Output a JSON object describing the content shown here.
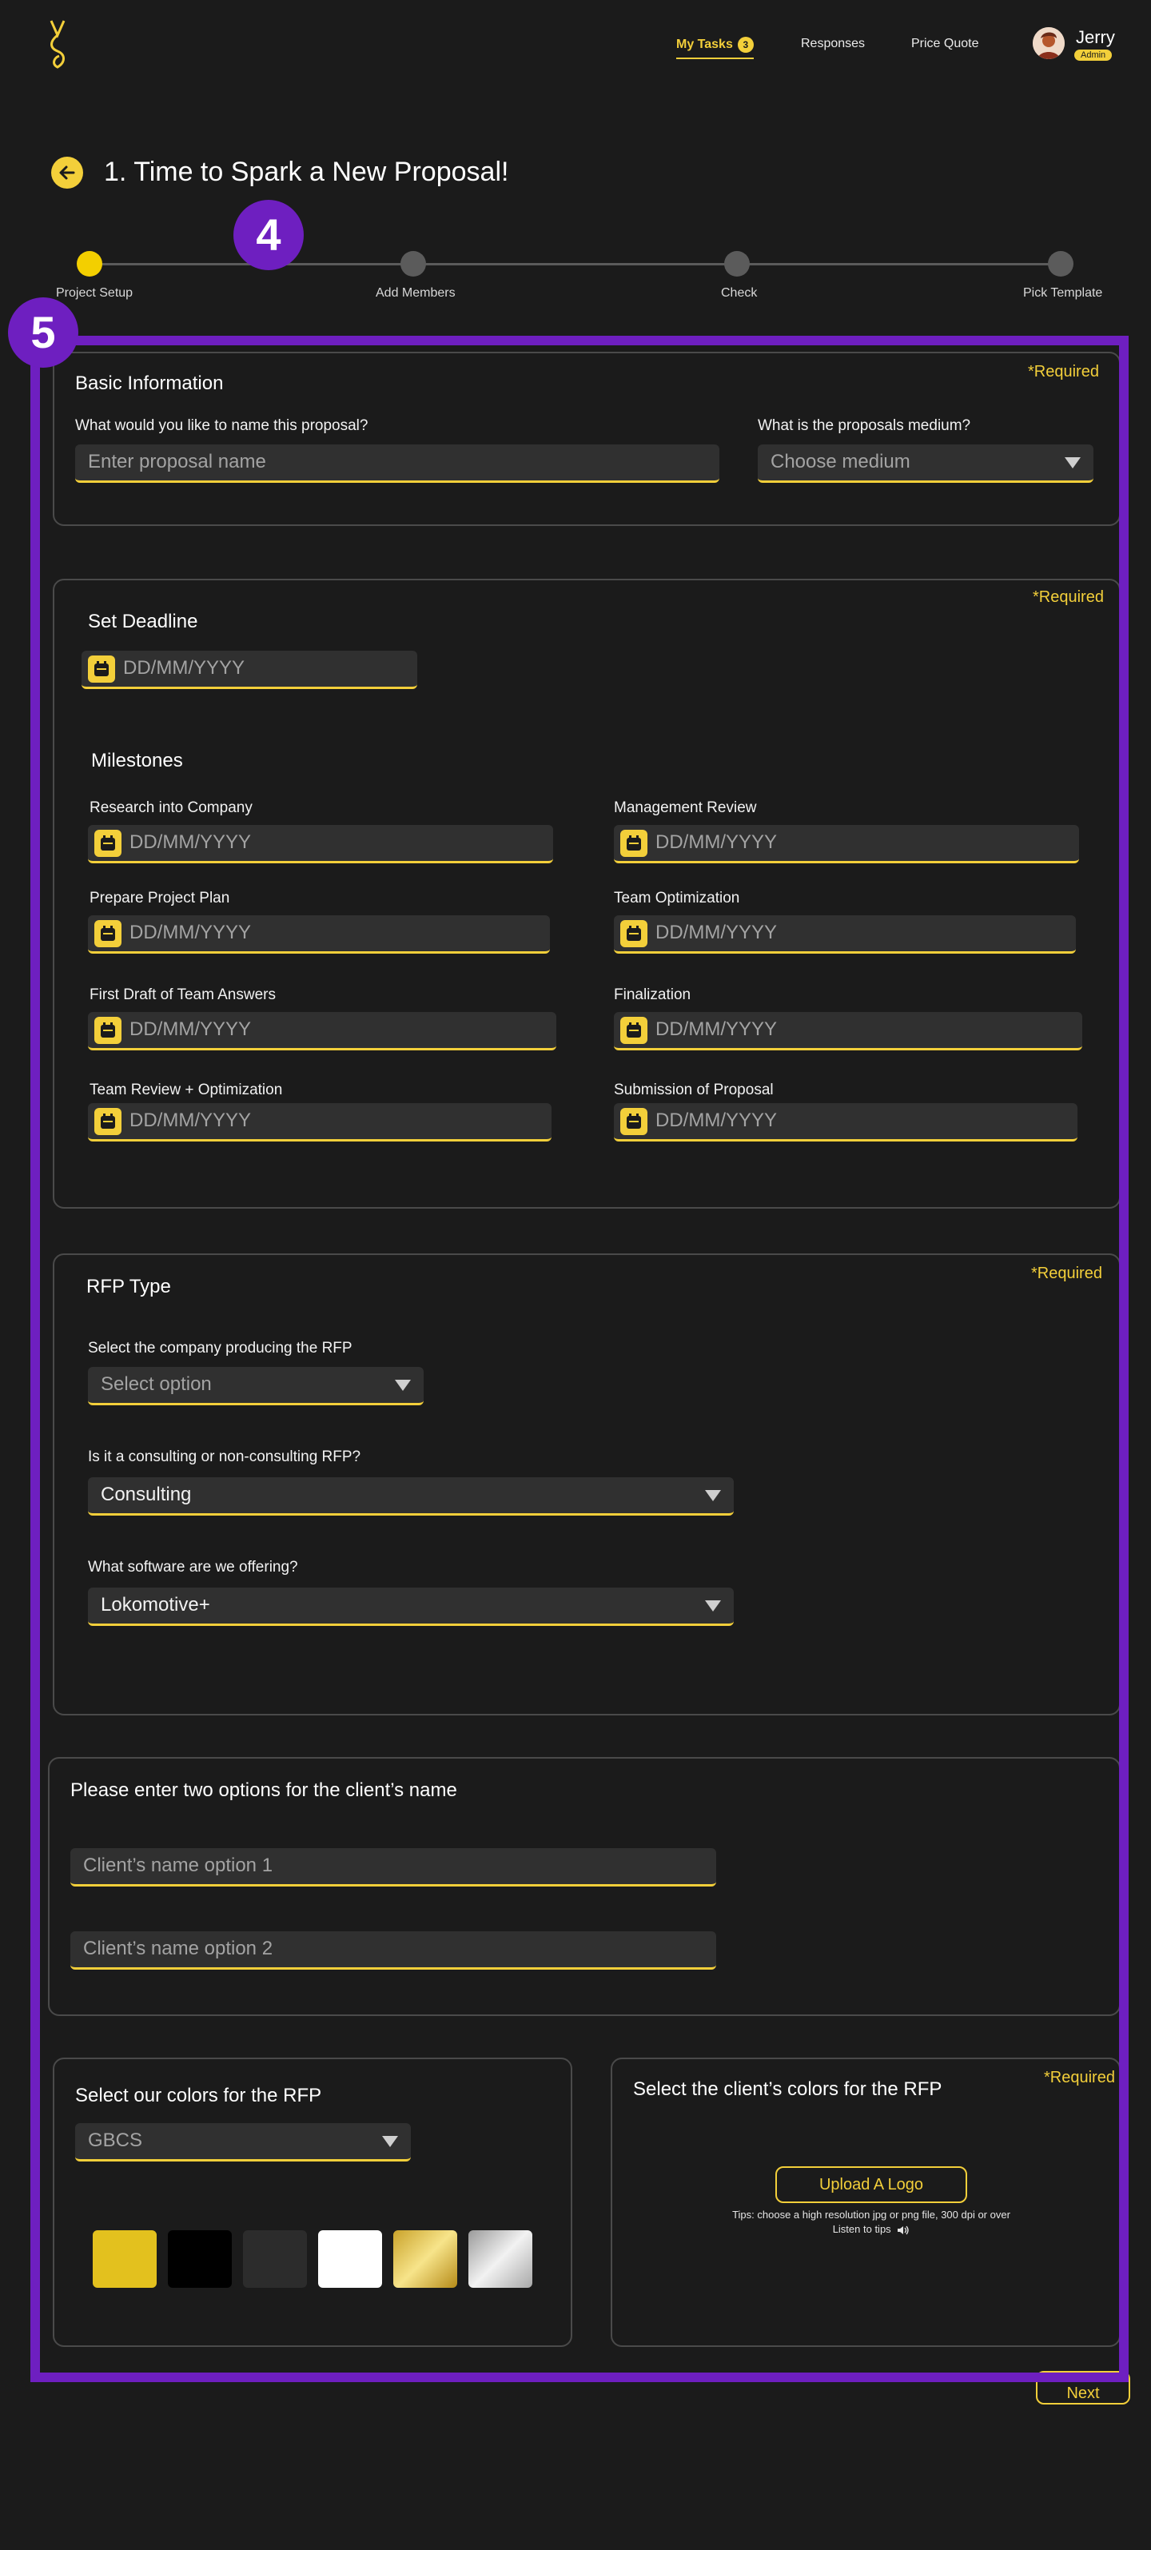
{
  "header": {
    "nav": {
      "my_tasks": "My Tasks",
      "my_tasks_count": "3",
      "responses": "Responses",
      "price_quote": "Price Quote"
    },
    "user": {
      "name": "Jerry",
      "role": "Admin"
    }
  },
  "page": {
    "title": "1. Time to Spark a New Proposal!"
  },
  "stepper": {
    "steps": [
      "Project Setup",
      "Add Members",
      "Check",
      "Pick Template"
    ]
  },
  "annotations": {
    "marker_4": "4",
    "marker_5": "5"
  },
  "basic_info": {
    "required": "*Required",
    "title": "Basic Information",
    "name_label": "What would you like to name this proposal?",
    "name_placeholder": "Enter proposal name",
    "medium_label": "What is the proposals medium?",
    "medium_value": "Choose medium"
  },
  "deadline": {
    "required": "*Required",
    "title": "Set Deadline",
    "date_placeholder": "DD/MM/YYYY",
    "milestones_title": "Milestones",
    "milestones": [
      "Research into Company",
      "Management Review",
      "Prepare Project Plan",
      "Team Optimization",
      "First Draft of Team Answers",
      "Finalization",
      "Team Review + Optimization",
      "Submission of Proposal"
    ]
  },
  "rfp": {
    "required": "*Required",
    "title": "RFP Type",
    "company_label": "Select the company producing the RFP",
    "company_value": "Select option",
    "consulting_label": "Is it a consulting or non-consulting RFP?",
    "consulting_value": "Consulting",
    "software_label": "What software are we offering?",
    "software_value": "Lokomotive+"
  },
  "client_name": {
    "title": "Please enter two options for the client’s name",
    "option1_placeholder": "Client’s name option 1",
    "option2_placeholder": "Client’s name option 2"
  },
  "our_colors": {
    "title": "Select our colors for the RFP",
    "palette_value": "GBCS",
    "swatches": [
      "#e3c11e",
      "#000000",
      "#2c2c2c",
      "#ffffff",
      "gold-gradient",
      "silver-gradient"
    ]
  },
  "client_colors": {
    "title": "Select the client’s colors for the RFP",
    "required": "*Required",
    "upload_label": "Upload A Logo",
    "tips_line1": "Tips: choose a high resolution jpg or png file, 300 dpi or over",
    "tips_line2": "Listen to tips"
  },
  "footer": {
    "next_label": "Next"
  },
  "colors": {
    "accent": "#f3cf3a",
    "background": "#1b1b1b",
    "annotation": "#6e1fc0"
  }
}
